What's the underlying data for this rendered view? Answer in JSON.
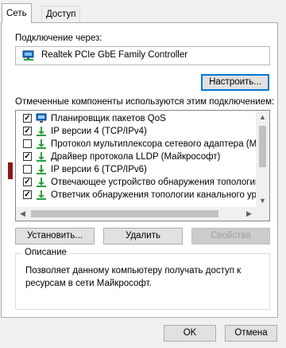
{
  "tabs": [
    {
      "label": "Сеть",
      "active": true
    },
    {
      "label": "Доступ",
      "active": false
    }
  ],
  "connect_using_label": "Подключение через:",
  "adapter": {
    "name": "Realtek PCIe GbE Family Controller",
    "icon": "network-adapter-icon"
  },
  "configure_button": "Настроить...",
  "components_label": "Отмеченные компоненты используются этим подключением:",
  "components": [
    {
      "label": "Планировщик пакетов QoS",
      "checked": true,
      "icon": "network-service-icon"
    },
    {
      "label": "IP версии 4 (TCP/IPv4)",
      "checked": true,
      "icon": "protocol-icon"
    },
    {
      "label": "Протокол мультиплексора сетевого адаптера (Май",
      "checked": false,
      "icon": "protocol-icon"
    },
    {
      "label": "Драйвер протокола LLDP (Майкрософт)",
      "checked": true,
      "icon": "protocol-icon"
    },
    {
      "label": "IP версии 6 (TCP/IPv6)",
      "checked": false,
      "icon": "protocol-icon"
    },
    {
      "label": "Отвечающее устройство обнаружения топологии к",
      "checked": true,
      "icon": "protocol-icon"
    },
    {
      "label": "Ответчик обнаружения топологии канального уров",
      "checked": true,
      "icon": "protocol-icon"
    }
  ],
  "buttons": {
    "install": "Установить...",
    "uninstall": "Удалить",
    "properties": "Свойства"
  },
  "description": {
    "legend": "Описание",
    "text": "Позволяет данному компьютеру получать доступ к ресурсам в сети Майкрософт."
  },
  "dialog_buttons": {
    "ok": "OK",
    "cancel": "Отмена"
  },
  "colors": {
    "accent": "#0078d7",
    "protocol_icon_green": "#2e9e3e",
    "left_marker": "#8b1a1a"
  }
}
